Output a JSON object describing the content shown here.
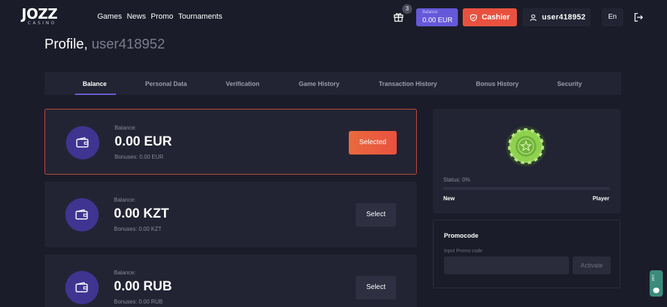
{
  "brand": {
    "logo_main": "JOZZ",
    "logo_sub": "CASINO"
  },
  "nav": [
    {
      "label": "Games"
    },
    {
      "label": "News"
    },
    {
      "label": "Promo"
    },
    {
      "label": "Tournaments"
    }
  ],
  "header": {
    "gift_count": "3",
    "balance_label": "Balance",
    "balance_value": "0.00 EUR",
    "cashier_label": "Cashier",
    "username": "user418952",
    "language": "En"
  },
  "profile": {
    "title": "Profile,",
    "username": "user418952"
  },
  "tabs": [
    {
      "label": "Balance",
      "active": true
    },
    {
      "label": "Personal Data"
    },
    {
      "label": "Verification"
    },
    {
      "label": "Game History"
    },
    {
      "label": "Transaction History"
    },
    {
      "label": "Bonus History"
    },
    {
      "label": "Security"
    }
  ],
  "balances": [
    {
      "label": "Balance:",
      "value": "0.00 EUR",
      "bonus": "Bonuses: 0.00 EUR",
      "button": "Selected"
    },
    {
      "label": "Balance:",
      "value": "0.00 KZT",
      "bonus": "Bonuses: 0.00 KZT",
      "button": "Select"
    },
    {
      "label": "Balance:",
      "value": "0.00 RUB",
      "bonus": "Bonuses: 0.00 RUB",
      "button": "Select"
    }
  ],
  "status": {
    "text": "Status: 0%",
    "progress_percent": 0,
    "level_from": "New",
    "level_to": "Player"
  },
  "promo": {
    "title": "Promocode",
    "input_label": "Input Promo code",
    "input_value": "",
    "button": "Activate"
  },
  "chat": {
    "label": "24/7"
  },
  "colors": {
    "accent": "#6559d9",
    "cashier": "#e9513f",
    "chip": "#8fd14f",
    "background": "#1b1c29",
    "panel": "#232433"
  }
}
